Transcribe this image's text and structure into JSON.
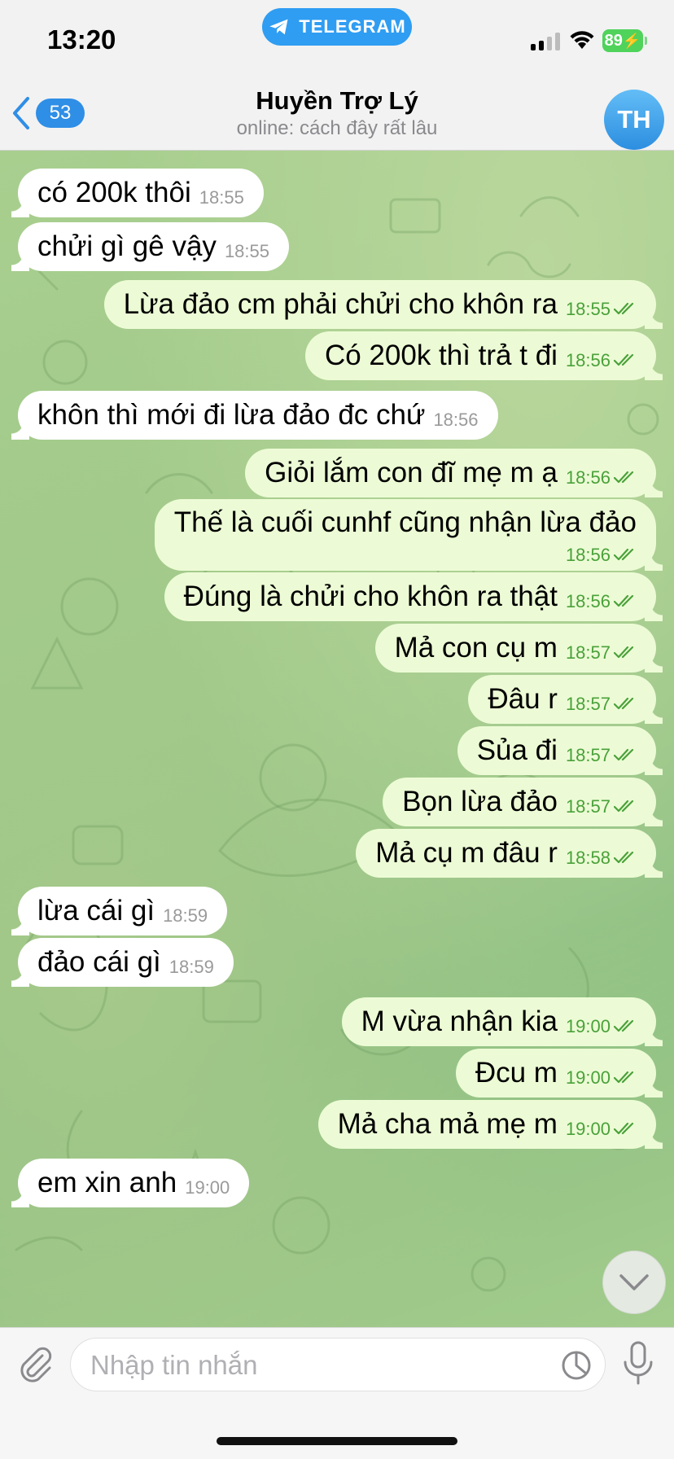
{
  "status_bar": {
    "time": "13:20",
    "app_pill": "TELEGRAM",
    "battery": "89"
  },
  "header": {
    "back_count": "53",
    "name": "Huyền Trợ Lý",
    "status": "online: cách đây rất lâu",
    "avatar_initials": "TH"
  },
  "messages": [
    {
      "dir": "in",
      "text": "có 200k thôi",
      "time": "18:55"
    },
    {
      "dir": "in",
      "text": "chửi gì gê vậy",
      "time": "18:55"
    },
    {
      "dir": "out",
      "text": "Lừa đảo cm phải chửi cho khôn ra",
      "time": "18:55"
    },
    {
      "dir": "out",
      "text": "Có 200k thì trả t đi",
      "time": "18:56"
    },
    {
      "dir": "in",
      "text": "khôn thì mới đi lừa đảo đc chứ",
      "time": "18:56"
    },
    {
      "dir": "out",
      "text": "Giỏi lắm con đĩ mẹ m ạ",
      "time": "18:56"
    },
    {
      "dir": "out",
      "text": "Thế là cuối cunhf cũng nhận lừa đảo",
      "time": "18:56"
    },
    {
      "dir": "out",
      "text": "Đúng là chửi cho khôn ra thật",
      "time": "18:56"
    },
    {
      "dir": "out",
      "text": "Mả con cụ m",
      "time": "18:57"
    },
    {
      "dir": "out",
      "text": "Đâu r",
      "time": "18:57"
    },
    {
      "dir": "out",
      "text": "Sủa đi",
      "time": "18:57"
    },
    {
      "dir": "out",
      "text": "Bọn lừa đảo",
      "time": "18:57"
    },
    {
      "dir": "out",
      "text": "Mả cụ m đâu r",
      "time": "18:58"
    },
    {
      "dir": "in",
      "text": "lừa cái gì",
      "time": "18:59"
    },
    {
      "dir": "in",
      "text": "đảo cái gì",
      "time": "18:59"
    },
    {
      "dir": "out",
      "text": "M vừa nhận kia",
      "time": "19:00"
    },
    {
      "dir": "out",
      "text": "Đcu m",
      "time": "19:00"
    },
    {
      "dir": "out",
      "text": "Mả cha mả mẹ m",
      "time": "19:00"
    },
    {
      "dir": "in",
      "text": "em xin anh",
      "time": "19:00"
    }
  ],
  "input": {
    "placeholder": "Nhập tin nhắn",
    "value": ""
  },
  "icons": {
    "attach": "paperclip-icon",
    "sticker": "sticker-icon",
    "mic": "microphone-icon",
    "scroll": "chevron-down-icon",
    "back": "chevron-left-icon"
  },
  "colors": {
    "accent": "#2f9df2",
    "outgoing_bubble": "#ecfbd5",
    "incoming_bubble": "#ffffff",
    "read_ticks": "#4aa13a"
  }
}
